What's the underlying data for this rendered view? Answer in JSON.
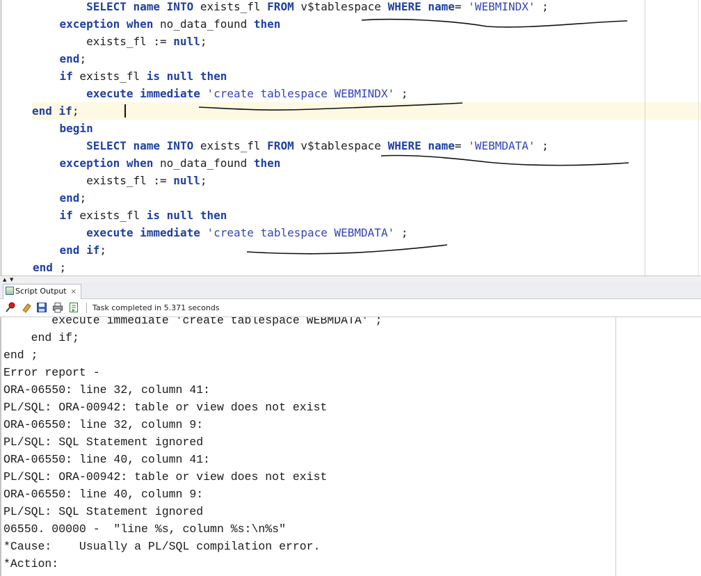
{
  "editor": {
    "lines": [
      {
        "indent": "        ",
        "tokens": [
          [
            "kw",
            "SELECT"
          ],
          [
            "id",
            " "
          ],
          [
            "kw",
            "name"
          ],
          [
            "id",
            " "
          ],
          [
            "kw",
            "INTO"
          ],
          [
            "id",
            " exists_fl "
          ],
          [
            "kw",
            "FROM"
          ],
          [
            "id",
            " v$tablespace "
          ],
          [
            "kw",
            "WHERE"
          ],
          [
            "id",
            " "
          ],
          [
            "kw",
            "name"
          ],
          [
            "id",
            "= "
          ],
          [
            "str",
            "'WEBMINDX'"
          ],
          [
            "id",
            " ;"
          ]
        ]
      },
      {
        "indent": "    ",
        "tokens": [
          [
            "kw",
            "exception"
          ],
          [
            "id",
            " "
          ],
          [
            "kw",
            "when"
          ],
          [
            "id",
            " no_data_found "
          ],
          [
            "kw",
            "then"
          ]
        ]
      },
      {
        "indent": "        ",
        "tokens": [
          [
            "id",
            "exists_fl := "
          ],
          [
            "kw",
            "null"
          ],
          [
            "id",
            ";"
          ]
        ]
      },
      {
        "indent": "    ",
        "tokens": [
          [
            "kw",
            "end"
          ],
          [
            "id",
            ";"
          ]
        ]
      },
      {
        "indent": "    ",
        "tokens": [
          [
            "kw",
            "if"
          ],
          [
            "id",
            " exists_fl "
          ],
          [
            "kw",
            "is"
          ],
          [
            "id",
            " "
          ],
          [
            "kw",
            "null"
          ],
          [
            "id",
            " "
          ],
          [
            "kw",
            "then"
          ]
        ]
      },
      {
        "indent": "        ",
        "tokens": [
          [
            "kw",
            "execute"
          ],
          [
            "id",
            " "
          ],
          [
            "kw",
            "immediate"
          ],
          [
            "id",
            " "
          ],
          [
            "str",
            "'create tablespace WEBMINDX'"
          ],
          [
            "id",
            " ;"
          ]
        ]
      },
      {
        "indent": "",
        "current": true,
        "tokens": [
          [
            "kw",
            "end"
          ],
          [
            "id",
            " "
          ],
          [
            "kw",
            "if"
          ],
          [
            "id",
            ";"
          ]
        ]
      },
      {
        "indent": "    ",
        "tokens": [
          [
            "kw",
            "begin"
          ]
        ]
      },
      {
        "indent": "        ",
        "tokens": [
          [
            "kw",
            "SELECT"
          ],
          [
            "id",
            " "
          ],
          [
            "kw",
            "name"
          ],
          [
            "id",
            " "
          ],
          [
            "kw",
            "INTO"
          ],
          [
            "id",
            " exists_fl "
          ],
          [
            "kw",
            "FROM"
          ],
          [
            "id",
            " v$tablespace "
          ],
          [
            "kw",
            "WHERE"
          ],
          [
            "id",
            " "
          ],
          [
            "kw",
            "name"
          ],
          [
            "id",
            "= "
          ],
          [
            "str",
            "'WEBMDATA'"
          ],
          [
            "id",
            " ;"
          ]
        ]
      },
      {
        "indent": "    ",
        "tokens": [
          [
            "kw",
            "exception"
          ],
          [
            "id",
            " "
          ],
          [
            "kw",
            "when"
          ],
          [
            "id",
            " no_data_found "
          ],
          [
            "kw",
            "then"
          ]
        ]
      },
      {
        "indent": "        ",
        "tokens": [
          [
            "id",
            "exists_fl := "
          ],
          [
            "kw",
            "null"
          ],
          [
            "id",
            ";"
          ]
        ]
      },
      {
        "indent": "    ",
        "tokens": [
          [
            "kw",
            "end"
          ],
          [
            "id",
            ";"
          ]
        ]
      },
      {
        "indent": "    ",
        "tokens": [
          [
            "kw",
            "if"
          ],
          [
            "id",
            " exists_fl "
          ],
          [
            "kw",
            "is"
          ],
          [
            "id",
            " "
          ],
          [
            "kw",
            "null"
          ],
          [
            "id",
            " "
          ],
          [
            "kw",
            "then"
          ]
        ]
      },
      {
        "indent": "        ",
        "tokens": [
          [
            "kw",
            "execute"
          ],
          [
            "id",
            " "
          ],
          [
            "kw",
            "immediate"
          ],
          [
            "id",
            " "
          ],
          [
            "str",
            "'create tablespace WEBMDATA'"
          ],
          [
            "id",
            " ;"
          ]
        ]
      },
      {
        "indent": "    ",
        "tokens": [
          [
            "kw",
            "end"
          ],
          [
            "id",
            " "
          ],
          [
            "kw",
            "if"
          ],
          [
            "id",
            ";"
          ]
        ]
      },
      {
        "indent": "",
        "tokens": [
          [
            "kw",
            "end"
          ],
          [
            "id",
            " ;"
          ]
        ]
      }
    ]
  },
  "panel": {
    "tab_label": "Script Output",
    "tab_close": "×",
    "status_text": "Task completed in 5.371 seconds",
    "toolbar_icons": [
      "pin-icon",
      "eraser-icon",
      "save-icon",
      "print-icon",
      "open-log-icon"
    ]
  },
  "output": {
    "lines": [
      "       execute immediate 'create tablespace WEBMDATA' ;",
      "    end if;",
      "end ;",
      "Error report -",
      "ORA-06550: line 32, column 41:",
      "PL/SQL: ORA-00942: table or view does not exist",
      "ORA-06550: line 32, column 9:",
      "PL/SQL: SQL Statement ignored",
      "ORA-06550: line 40, column 41:",
      "PL/SQL: ORA-00942: table or view does not exist",
      "ORA-06550: line 40, column 9:",
      "PL/SQL: SQL Statement ignored",
      "06550. 00000 -  \"line %s, column %s:\\n%s\"",
      "*Cause:    Usually a PL/SQL compilation error.",
      "*Action:"
    ]
  },
  "colors": {
    "keyword": "#1f40a0",
    "string": "#3344bb",
    "current_line": "#fdf9e3",
    "ink_annotation": "#111111"
  }
}
